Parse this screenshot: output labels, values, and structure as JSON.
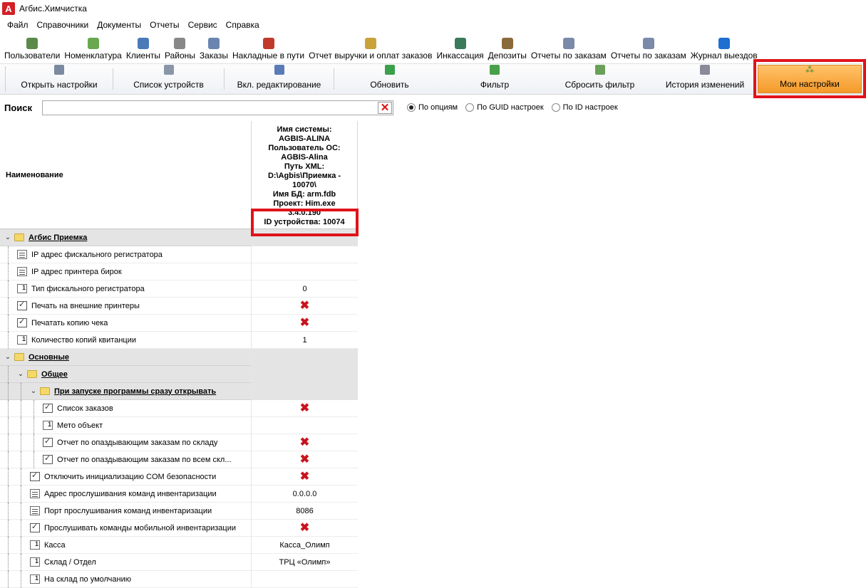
{
  "window": {
    "title": "Агбис.Химчистка",
    "logo_letter": "A"
  },
  "menu": [
    "Файл",
    "Справочники",
    "Документы",
    "Отчеты",
    "Сервис",
    "Справка"
  ],
  "toolbar1": [
    {
      "label": "Пользователи",
      "icon": "users-icon",
      "color": "#5a8a4a"
    },
    {
      "label": "Номенклатура",
      "icon": "nomenclature-icon",
      "color": "#6aa84f"
    },
    {
      "label": "Клиенты",
      "icon": "clients-icon",
      "color": "#4a7ab8"
    },
    {
      "label": "Районы",
      "icon": "districts-icon",
      "color": "#888888"
    },
    {
      "label": "Заказы",
      "icon": "orders-icon",
      "color": "#6a86b0"
    },
    {
      "label": "Накладные в пути",
      "icon": "truck-icon",
      "color": "#c0392b"
    },
    {
      "label": "Отчет выручки и оплат заказов",
      "icon": "books-icon",
      "color": "#c9a23a"
    },
    {
      "label": "Инкассация",
      "icon": "money-icon",
      "color": "#3a7a5a"
    },
    {
      "label": "Депозиты",
      "icon": "deposit-icon",
      "color": "#8a6a3a"
    },
    {
      "label": "Отчеты по заказам",
      "icon": "report-icon",
      "color": "#7a8aa8"
    },
    {
      "label": "Отчеты по заказам",
      "icon": "report-icon",
      "color": "#7a8aa8"
    },
    {
      "label": "Журнал выездов",
      "icon": "arrow-right-icon",
      "color": "#1e6fd0"
    }
  ],
  "toolbar2": [
    {
      "label": "Открыть настройки",
      "icon": "gears-icon",
      "color": "#7a8aa0",
      "width": 150
    },
    {
      "label": "Список устройств",
      "icon": "devices-icon",
      "color": "#8a96a8",
      "width": 155
    },
    {
      "label": "Вкл. редактирование",
      "icon": "edit-grid-icon",
      "color": "#5a7ab8",
      "width": 153
    },
    {
      "label": "Обновить",
      "icon": "refresh-icon",
      "color": "#3aa04a",
      "width": 155
    },
    {
      "label": "Фильтр",
      "icon": "filter-icon",
      "color": "#4aa04a",
      "width": 140
    },
    {
      "label": "Сбросить фильтр",
      "icon": "filter-reset-icon",
      "color": "#6aa05a",
      "width": 155
    },
    {
      "label": "История изменений",
      "icon": "history-icon",
      "color": "#8a8a9a",
      "width": 140
    }
  ],
  "my_settings": {
    "label": "Мои настройки",
    "color": "#f5a03a"
  },
  "search": {
    "label": "Поиск",
    "value": "",
    "clear_glyph": "✕",
    "options": [
      {
        "label": "По опциям",
        "selected": true
      },
      {
        "label": "По GUID настроек",
        "selected": false
      },
      {
        "label": "По ID настроек",
        "selected": false
      }
    ]
  },
  "grid": {
    "name_header": "Наименование",
    "device_header": [
      "Имя системы:",
      "AGBIS-ALINA",
      "Пользователь ОС:",
      "AGBIS-Alina",
      "Путь XML:",
      "D:\\Agbis\\Приемка -",
      "10070\\",
      "Имя БД: arm.fdb",
      "Проект: Him.exe",
      "3.4.0.190",
      "ID устройства: 10074"
    ],
    "rows": [
      {
        "type": "group",
        "level": 0,
        "label": "Агбис Приемка",
        "value": ""
      },
      {
        "type": "list",
        "level": 1,
        "label": "IP адрес фискального регистратора",
        "value": ""
      },
      {
        "type": "list",
        "level": 1,
        "label": "IP адрес принтера бирок",
        "value": ""
      },
      {
        "type": "num",
        "level": 1,
        "label": "Тип фискального регистратора",
        "value": "0"
      },
      {
        "type": "check",
        "level": 1,
        "label": "Печать на внешние принтеры",
        "value": "✖"
      },
      {
        "type": "check",
        "level": 1,
        "label": "Печатать копию чека",
        "value": "✖"
      },
      {
        "type": "num",
        "level": 1,
        "label": "Количество копий квитанции",
        "value": "1"
      },
      {
        "type": "group",
        "level": 0,
        "label": "Основные",
        "value": ""
      },
      {
        "type": "group",
        "level": 1,
        "label": "Общее",
        "value": ""
      },
      {
        "type": "group",
        "level": 2,
        "label": "При запуске программы сразу открывать",
        "value": ""
      },
      {
        "type": "check",
        "level": 3,
        "label": "Список заказов",
        "value": "✖"
      },
      {
        "type": "num",
        "level": 3,
        "label": "Мето объект",
        "value": ""
      },
      {
        "type": "check",
        "level": 3,
        "label": "Отчет по опаздывающим заказам по складу",
        "value": "✖"
      },
      {
        "type": "check",
        "level": 3,
        "label": "Отчет по опаздывающим заказам по всем скл...",
        "value": "✖"
      },
      {
        "type": "check",
        "level": 2,
        "label": "Отключить инициализацию COM безопасности",
        "value": "✖"
      },
      {
        "type": "list",
        "level": 2,
        "label": "Адрес прослушивания команд инвентаризации",
        "value": "0.0.0.0"
      },
      {
        "type": "list",
        "level": 2,
        "label": "Порт прослушивания команд инвентаризации",
        "value": "8086"
      },
      {
        "type": "check",
        "level": 2,
        "label": "Прослушивать команды мобильной инвентаризации",
        "value": "✖"
      },
      {
        "type": "num",
        "level": 2,
        "label": "Касса",
        "value": "Касса_Олимп"
      },
      {
        "type": "num",
        "level": 2,
        "label": "Склад / Отдел",
        "value": "ТРЦ «Олимп»"
      },
      {
        "type": "num",
        "level": 2,
        "label": "На склад по умолчанию",
        "value": ""
      }
    ]
  },
  "colors": {
    "highlight_frame": "#e0121b",
    "x_mark": "#c8141c",
    "group_bg": "#e4e4e4"
  }
}
